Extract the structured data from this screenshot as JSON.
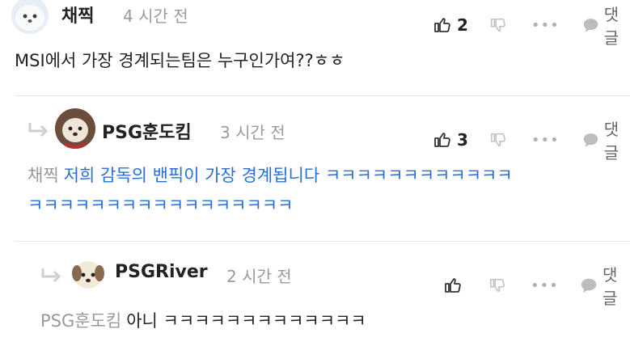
{
  "comments": [
    {
      "author": "채찍",
      "time": "4 시간 전",
      "likes": "2",
      "reply_label": "댓글",
      "text": "MSI에서 가장 경계되는팀은 누구인가여??ㅎㅎ"
    },
    {
      "author": "PSG훈도킴",
      "time": "3 시간 전",
      "likes": "3",
      "reply_label": "댓글",
      "mention": "채찍",
      "text_line1": "저희 감독의 밴픽이 가장 경계됩니다 ㅋㅋㅋㅋㅋㅋㅋㅋㅋㅋㅋㅋ",
      "text_line2": "ㅋㅋㅋㅋㅋㅋㅋㅋㅋㅋㅋㅋㅋㅋㅋㅋㅋ"
    },
    {
      "author": "PSGRiver",
      "time": "2 시간 전",
      "likes": "",
      "reply_label": "댓글",
      "mention": "PSG훈도킴",
      "text": "아니 ㅋㅋㅋㅋㅋㅋㅋㅋㅋㅋㅋㅋㅋ"
    }
  ],
  "icons": {
    "like": "thumbs-up-icon",
    "dislike": "thumbs-down-icon",
    "more": "more-icon",
    "reply": "speech-bubble-icon",
    "reply_arrow": "reply-arrow-icon"
  },
  "colors": {
    "link": "#2a6fd6",
    "muted": "#9a9a9a"
  }
}
